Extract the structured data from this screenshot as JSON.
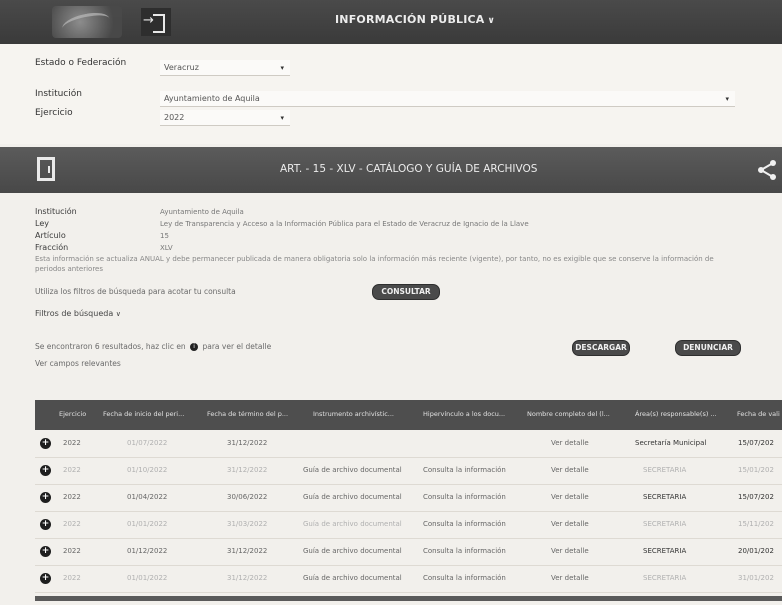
{
  "header": {
    "title": "INFORMACIÓN PÚBLICA",
    "chevron": "chevron-down-icon"
  },
  "filters": {
    "estado_label": "Estado o Federación",
    "estado_value": "Veracruz",
    "institucion_label": "Institución",
    "institucion_value": "Ayuntamiento de Aquila",
    "ejercicio_label": "Ejercicio",
    "ejercicio_value": "2022"
  },
  "section": {
    "title": "ART. - 15 - XLV - CATÁLOGO Y GUÍA DE ARCHIVOS"
  },
  "info": {
    "institucion_label": "Institución",
    "institucion_value": "Ayuntamiento de Aquila",
    "ley_label": "Ley",
    "ley_value": "Ley de Transparencia y Acceso a la Información Pública para el Estado de Veracruz de Ignacio de la Llave",
    "articulo_label": "Artículo",
    "articulo_value": "15",
    "fraccion_label": "Fracción",
    "fraccion_value": "XLV",
    "note": "Esta información se actualiza ANUAL y debe permanecer publicada de manera obligatoria solo la información más reciente (vigente), por tanto, no es exigible que se conserve la información de periodos anteriores",
    "filters_hint": "Utiliza los filtros de búsqueda para acotar tu consulta",
    "consultar_label": "CONSULTAR",
    "filtros_label": "Filtros de búsqueda",
    "results_prefix": "Se encontraron 6 resultados, haz clic en",
    "results_suffix": "para ver el detalle",
    "descargar_label": "DESCARGAR",
    "denunciar_label": "DENUNCIAR",
    "ver_campos": "Ver campos relevantes"
  },
  "table": {
    "headers": [
      "Ejercicio",
      "Fecha de inicio del peri...",
      "Fecha de término del p...",
      "Instrumento archivístic...",
      "Hipervínculo a los docu...",
      "Nombre completo del (l...",
      "Área(s) responsable(s) ...",
      "Fecha de vali"
    ],
    "rows": [
      [
        "2022",
        "01/07/2022",
        "31/12/2022",
        "",
        "",
        "Ver detalle",
        "Secretaría Municipal",
        "15/07/202"
      ],
      [
        "2022",
        "01/10/2022",
        "31/12/2022",
        "Guía de archivo documental",
        "Consulta la información",
        "Ver detalle",
        "SECRETARIA",
        "15/01/202"
      ],
      [
        "2022",
        "01/04/2022",
        "30/06/2022",
        "Guía de archivo documental",
        "Consulta la información",
        "Ver detalle",
        "SECRETARIA",
        "15/07/202"
      ],
      [
        "2022",
        "01/01/2022",
        "31/03/2022",
        "Guía de archivo documental",
        "Consulta la información",
        "Ver detalle",
        "SECRETARIA",
        "15/11/202"
      ],
      [
        "2022",
        "01/12/2022",
        "31/12/2022",
        "Guía de archivo documental",
        "Consulta la información",
        "Ver detalle",
        "SECRETARIA",
        "20/01/202"
      ],
      [
        "2022",
        "01/01/2022",
        "31/12/2022",
        "Guía de archivo documental",
        "Consulta la información",
        "Ver detalle",
        "SECRETARIA",
        "31/01/202"
      ]
    ]
  }
}
